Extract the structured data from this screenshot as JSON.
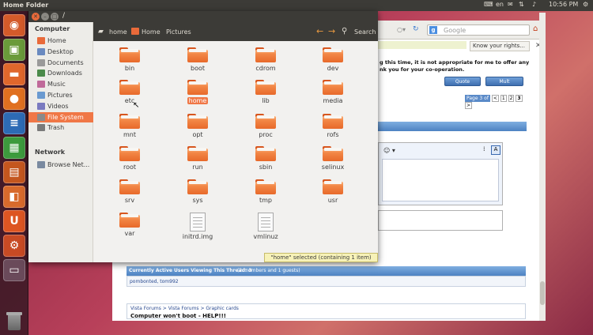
{
  "top_panel": {
    "title": "Home Folder",
    "keyboard": "en",
    "time": "10:56 PM"
  },
  "launcher": {
    "items": [
      {
        "name": "dash",
        "glyph": "◉",
        "color": "#d45a2a"
      },
      {
        "name": "photo-app",
        "glyph": "▣",
        "color": "#6a9a3a"
      },
      {
        "name": "files",
        "glyph": "▬",
        "color": "#e0672c"
      },
      {
        "name": "firefox",
        "glyph": "●",
        "color": "#e07020"
      },
      {
        "name": "writer",
        "glyph": "≡",
        "color": "#2d6bb5"
      },
      {
        "name": "calc",
        "glyph": "▦",
        "color": "#3d9a3d"
      },
      {
        "name": "impress",
        "glyph": "▤",
        "color": "#c4561e"
      },
      {
        "name": "software-center",
        "glyph": "◧",
        "color": "#d86a2c"
      },
      {
        "name": "ubuntu-one",
        "glyph": "U",
        "color": "#dd5522"
      },
      {
        "name": "settings",
        "glyph": "⚙",
        "color": "#c84a24"
      },
      {
        "name": "workspaces",
        "glyph": "▭",
        "color": "#6a4a5a"
      }
    ]
  },
  "file_manager": {
    "window_title": "/",
    "breadcrumb": [
      "home",
      "Home",
      "Pictures"
    ],
    "search_label": "Search",
    "sidebar": {
      "computer_heading": "Computer",
      "computer_items": [
        "Home",
        "Desktop",
        "Documents",
        "Downloads",
        "Music",
        "Pictures",
        "Videos",
        "File System",
        "Trash"
      ],
      "selected": "File System",
      "network_heading": "Network",
      "network_items": [
        "Browse Net..."
      ]
    },
    "items": [
      {
        "label": "bin",
        "type": "folder"
      },
      {
        "label": "boot",
        "type": "folder"
      },
      {
        "label": "cdrom",
        "type": "folder"
      },
      {
        "label": "dev",
        "type": "folder"
      },
      {
        "label": "etc",
        "type": "folder"
      },
      {
        "label": "home",
        "type": "folder",
        "selected": true
      },
      {
        "label": "lib",
        "type": "folder"
      },
      {
        "label": "media",
        "type": "folder"
      },
      {
        "label": "mnt",
        "type": "folder"
      },
      {
        "label": "opt",
        "type": "folder"
      },
      {
        "label": "proc",
        "type": "folder"
      },
      {
        "label": "rofs",
        "type": "folder"
      },
      {
        "label": "root",
        "type": "folder"
      },
      {
        "label": "run",
        "type": "folder"
      },
      {
        "label": "sbin",
        "type": "folder"
      },
      {
        "label": "selinux",
        "type": "folder"
      },
      {
        "label": "srv",
        "type": "folder"
      },
      {
        "label": "sys",
        "type": "folder"
      },
      {
        "label": "tmp",
        "type": "folder"
      },
      {
        "label": "usr",
        "type": "folder"
      },
      {
        "label": "var",
        "type": "folder"
      },
      {
        "label": "initrd.img",
        "type": "file"
      },
      {
        "label": "vmlinuz",
        "type": "file"
      }
    ],
    "status": "\"home\" selected (containing 1 item)"
  },
  "browser": {
    "search_placeholder": "Google",
    "tab_label": "Know your rights...",
    "notice_line1": "g this time, it is not appropriate for me to offer any",
    "notice_line2": "nk you for your co-operation.",
    "quote_button": "Quote",
    "multi_button": "Mult",
    "pager": [
      "Page 3 of",
      "<",
      "1",
      "2",
      "3",
      ">"
    ],
    "active_users": "Currently Active Users Viewing This Thread: 3",
    "active_users_detail": "(2 members and 1 guests)",
    "users_list": "pombonted, tom992",
    "forum_path": "Vista Forums > Vista Forums > Graphic cards",
    "thread_title": "Computer won't boot - HELP!!!"
  }
}
